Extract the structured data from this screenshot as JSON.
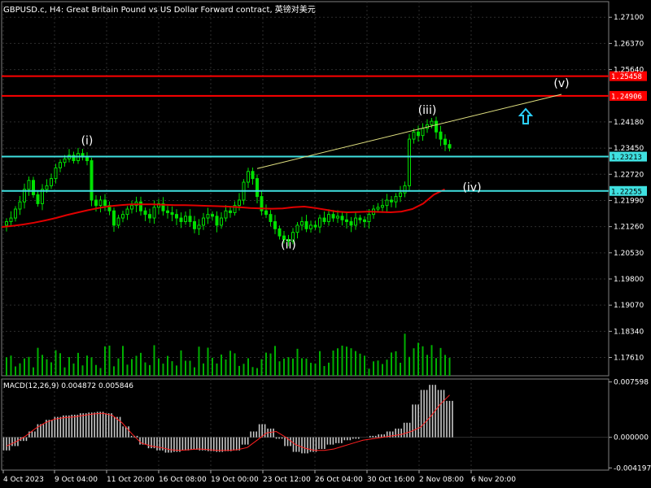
{
  "window": {
    "title": "GBPUSD.c, H4:  Great Britain Pound vs US Dollar Forward contract, 英镑对美元"
  },
  "colors": {
    "background": "#000000",
    "grid": "#2e2e2e",
    "candles": "#00e000",
    "volumes": "#00b000",
    "ma": "#e00000",
    "resistance": "#ff0000",
    "support": "#3fe0e0",
    "trendline": "#e0e080",
    "arrow": "#2ad0ff",
    "macd_hist": "#c8c8c8",
    "macd_signal": "#ff2020"
  },
  "chart_data": [
    {
      "type": "candlestick",
      "symbol": "GBPUSD.c",
      "timeframe": "H4",
      "ylim": [
        1.171,
        1.274
      ],
      "yticks": [
        "1.27100",
        "1.26370",
        "1.25640",
        "1.24180",
        "1.23450",
        "1.22720",
        "1.21990",
        "1.21260",
        "1.20530",
        "1.19800",
        "1.19070",
        "1.18340",
        "1.17610"
      ],
      "xticks": [
        "4 Oct 2023",
        "9 Oct 04:00",
        "11 Oct 20:00",
        "16 Oct 08:00",
        "19 Oct 00:00",
        "23 Oct 12:00",
        "26 Oct 04:00",
        "30 Oct 16:00",
        "2 Nov 08:00",
        "6 Nov 20:00"
      ],
      "close_path": [
        1.214,
        1.215,
        1.2175,
        1.2195,
        1.223,
        1.2255,
        1.2215,
        1.219,
        1.223,
        1.224,
        1.226,
        1.229,
        1.2305,
        1.2315,
        1.2325,
        1.231,
        1.233,
        1.232,
        1.231,
        1.22,
        1.2185,
        1.22,
        1.2185,
        1.217,
        1.213,
        1.215,
        1.216,
        1.2175,
        1.2185,
        1.2195,
        1.217,
        1.216,
        1.215,
        1.218,
        1.219,
        1.217,
        1.2165,
        1.216,
        1.215,
        1.214,
        1.2155,
        1.214,
        1.212,
        1.213,
        1.215,
        1.216,
        1.2155,
        1.213,
        1.215,
        1.217,
        1.2165,
        1.2185,
        1.22,
        1.225,
        1.228,
        1.226,
        1.221,
        1.217,
        1.216,
        1.214,
        1.212,
        1.21,
        1.209,
        1.2085,
        1.211,
        1.213,
        1.214,
        1.212,
        1.213,
        1.2125,
        1.215,
        1.214,
        1.216,
        1.215,
        1.2155,
        1.2145,
        1.214,
        1.213,
        1.215,
        1.2145,
        1.214,
        1.216,
        1.2175,
        1.218,
        1.2185,
        1.22,
        1.2195,
        1.221,
        1.222,
        1.224,
        1.237,
        1.239,
        1.238,
        1.24,
        1.241,
        1.242,
        1.239,
        1.237,
        1.2355,
        1.2345
      ],
      "ma_path": [
        1.2125,
        1.2128,
        1.2132,
        1.2137,
        1.2143,
        1.215,
        1.2158,
        1.2165,
        1.2172,
        1.2178,
        1.2183,
        1.2186,
        1.2188,
        1.2188,
        1.2188,
        1.2187,
        1.2186,
        1.2186,
        1.2185,
        1.2184,
        1.2183,
        1.2182,
        1.218,
        1.2178,
        1.2177,
        1.2176,
        1.2177,
        1.218,
        1.2182,
        1.2178,
        1.2173,
        1.2168,
        1.2166,
        1.2167,
        1.2168,
        1.2167,
        1.2166,
        1.2168,
        1.2175,
        1.219,
        1.2215,
        1.223
      ],
      "horizontal_lines": [
        {
          "kind": "resistance",
          "value": 1.25458,
          "label": "1.25458"
        },
        {
          "kind": "resistance",
          "value": 1.24906,
          "label": "1.24906"
        },
        {
          "kind": "support",
          "value": 1.23213,
          "label": "1.23213"
        },
        {
          "kind": "support",
          "value": 1.22255,
          "label": "1.22255"
        }
      ],
      "trendline": {
        "from": [
          56,
          1.2288
        ],
        "to": [
          124,
          1.2495
        ]
      },
      "wave_labels": [
        {
          "text": "(i)",
          "bar": 18,
          "value": 1.2355
        },
        {
          "text": "(ii)",
          "bar": 63,
          "value": 1.2065
        },
        {
          "text": "(iii)",
          "bar": 94,
          "value": 1.244
        },
        {
          "text": "(iv)",
          "bar": 104,
          "value": 1.2225
        },
        {
          "text": "(v)",
          "bar": 124,
          "value": 1.2515
        }
      ]
    },
    {
      "type": "macd",
      "title": "MACD(12,26,9) 0.004872 0.005846",
      "ylim": [
        -0.0045,
        0.008
      ],
      "yticks": [
        "0.007598",
        "0.000000",
        "-0.004197"
      ],
      "hist_path": [
        -0.0018,
        -0.0012,
        -0.0005,
        0.0008,
        0.0018,
        0.0024,
        0.0028,
        0.003,
        0.0031,
        0.0033,
        0.0034,
        0.0035,
        0.0033,
        0.0028,
        0.0015,
        0.0002,
        -0.001,
        -0.0015,
        -0.0018,
        -0.0021,
        -0.002,
        -0.0018,
        -0.0017,
        -0.0018,
        -0.0019,
        -0.002,
        -0.0019,
        -0.0018,
        -0.001,
        0.0008,
        0.0018,
        0.0012,
        -0.0002,
        -0.0012,
        -0.002,
        -0.0022,
        -0.002,
        -0.0016,
        -0.001,
        -0.0008,
        -0.0004,
        -0.0002,
        0.0,
        0.0002,
        0.0004,
        0.0008,
        0.0012,
        0.002,
        0.0045,
        0.0065,
        0.0072,
        0.0065,
        0.005
      ],
      "signal_path": [
        -0.0012,
        -0.0006,
        0.0002,
        0.0012,
        0.002,
        0.0025,
        0.0027,
        0.0028,
        0.003,
        0.0032,
        0.0033,
        0.003,
        0.002,
        0.0005,
        -0.0008,
        -0.0012,
        -0.0014,
        -0.0017,
        -0.0018,
        -0.0017,
        -0.0016,
        -0.0017,
        -0.0018,
        -0.0018,
        -0.0017,
        -0.0014,
        -0.0004,
        0.0006,
        0.0008,
        0.0,
        -0.001,
        -0.0015,
        -0.0018,
        -0.0018,
        -0.0016,
        -0.0012,
        -0.0008,
        -0.0004,
        -0.0002,
        0.0,
        0.0002,
        0.0004,
        0.0008,
        0.0014,
        0.0028,
        0.0045,
        0.0058
      ]
    }
  ]
}
